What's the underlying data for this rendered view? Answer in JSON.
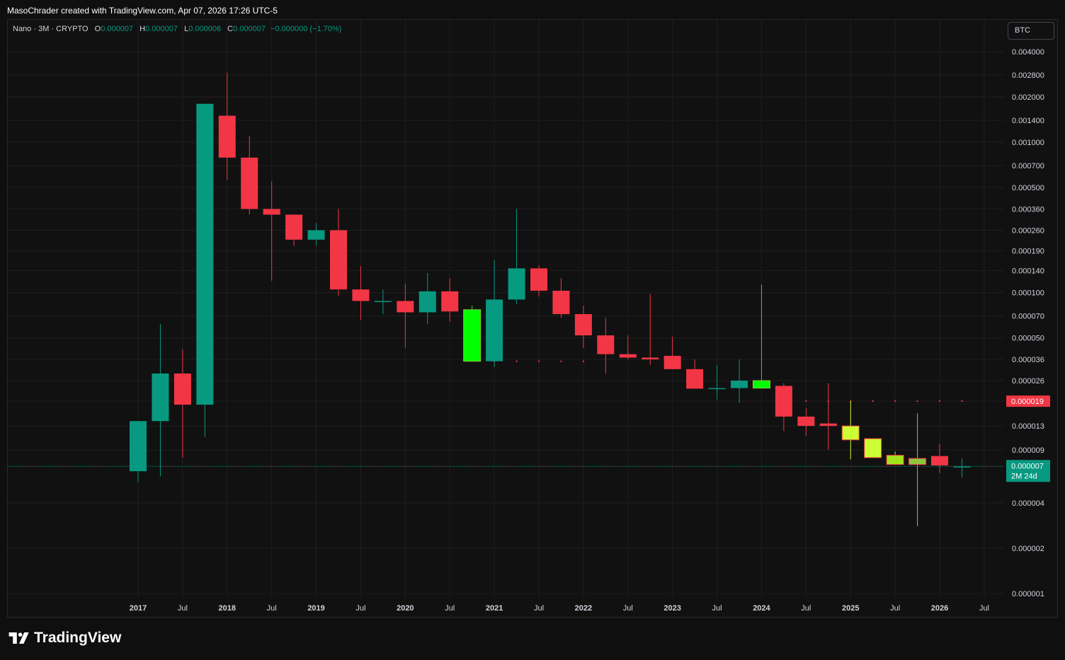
{
  "header": {
    "author": "MasoChrader",
    "attribution": "MasoChrader created with TradingView.com, Apr 07, 2026 17:26 UTC-5"
  },
  "legend": {
    "symbol": "Nano · 3M · CRYPTO",
    "o_label": "O",
    "o_value": "0.000007",
    "h_label": "H",
    "h_value": "0.000007",
    "l_label": "L",
    "l_value": "0.000006",
    "c_label": "C",
    "c_value": "0.000007",
    "change": "−0.000000 (−1.70%)"
  },
  "currency_button": "BTC",
  "footer": {
    "brand": "TradingView"
  },
  "colors": {
    "up": "#089981",
    "down": "#f23645",
    "bright_up": "#00ff00",
    "yellow_up": "#ccff33",
    "lime": "#a4e31a",
    "olive": "#8cc63f",
    "grid": "#1f1f1f",
    "marker": "#f23645",
    "price_line": "#089981"
  },
  "chart_data": {
    "type": "candlestick",
    "scale": "log",
    "y_ticks": [
      "0.004000",
      "0.002800",
      "0.002000",
      "0.001400",
      "0.001000",
      "0.000700",
      "0.000500",
      "0.000360",
      "0.000260",
      "0.000190",
      "0.000140",
      "0.000100",
      "0.000070",
      "0.000050",
      "0.000036",
      "0.000026",
      "0.000019",
      "0.000013",
      "0.000009",
      "0.000007",
      "0.000004",
      "0.000002",
      "0.000001"
    ],
    "x_ticks": [
      "2017",
      "Jul",
      "2018",
      "Jul",
      "2019",
      "Jul",
      "2020",
      "Jul",
      "2021",
      "Jul",
      "2022",
      "Jul",
      "2023",
      "Jul",
      "2024",
      "Jul",
      "2025",
      "Jul",
      "2026",
      "Jul"
    ],
    "x_range": [
      "2016-01",
      "2027-01"
    ],
    "last_price": {
      "value": "0.000007",
      "countdown": "2M 24d"
    },
    "marker_label": "0.000019",
    "candles": [
      {
        "date": "2017-01",
        "o": 6.5e-06,
        "h": 9e-06,
        "l": 5.5e-06,
        "c": 1.4e-05,
        "color": "up"
      },
      {
        "date": "2017-04",
        "o": 1.4e-05,
        "h": 6.2e-05,
        "l": 6e-06,
        "c": 2.9e-05,
        "color": "up"
      },
      {
        "date": "2017-07",
        "o": 2.9e-05,
        "h": 4.2e-05,
        "l": 8e-06,
        "c": 1.8e-05,
        "color": "down"
      },
      {
        "date": "2017-10",
        "o": 1.8e-05,
        "h": 0.0018,
        "l": 1.1e-05,
        "c": 0.0018,
        "color": "up"
      },
      {
        "date": "2018-01",
        "o": 0.0015,
        "h": 0.0029,
        "l": 0.00056,
        "c": 0.00079,
        "color": "down"
      },
      {
        "date": "2018-04",
        "o": 0.00079,
        "h": 0.0011,
        "l": 0.00033,
        "c": 0.00036,
        "color": "down"
      },
      {
        "date": "2018-07",
        "o": 0.00036,
        "h": 0.00055,
        "l": 0.00012,
        "c": 0.00033,
        "color": "down"
      },
      {
        "date": "2018-10",
        "o": 0.00033,
        "h": 0.00033,
        "l": 0.000205,
        "c": 0.000225,
        "color": "down"
      },
      {
        "date": "2019-01",
        "o": 0.000225,
        "h": 0.00029,
        "l": 0.000205,
        "c": 0.00026,
        "color": "up"
      },
      {
        "date": "2019-04",
        "o": 0.00026,
        "h": 0.00036,
        "l": 9.5e-05,
        "c": 0.000105,
        "color": "down"
      },
      {
        "date": "2019-07",
        "o": 0.000105,
        "h": 0.00015,
        "l": 6.6e-05,
        "c": 8.8e-05,
        "color": "down"
      },
      {
        "date": "2019-10",
        "o": 8.8e-05,
        "h": 0.000105,
        "l": 7.2e-05,
        "c": 8.8e-05,
        "color": "up"
      },
      {
        "date": "2020-01",
        "o": 8.8e-05,
        "h": 0.000115,
        "l": 4.3e-05,
        "c": 7.4e-05,
        "color": "down"
      },
      {
        "date": "2020-04",
        "o": 7.4e-05,
        "h": 0.000135,
        "l": 6.2e-05,
        "c": 0.000102,
        "color": "up"
      },
      {
        "date": "2020-07",
        "o": 0.000102,
        "h": 0.000125,
        "l": 6.4e-05,
        "c": 7.5e-05,
        "color": "down"
      },
      {
        "date": "2020-10",
        "o": 3.5e-05,
        "h": 8.2e-05,
        "l": 3.5e-05,
        "c": 7.7e-05,
        "color": "bright_up"
      },
      {
        "date": "2021-01",
        "o": 3.5e-05,
        "h": 0.000165,
        "l": 3.2e-05,
        "c": 9e-05,
        "color": "up"
      },
      {
        "date": "2021-04",
        "o": 9e-05,
        "h": 0.00036,
        "l": 8.4e-05,
        "c": 0.000145,
        "color": "up"
      },
      {
        "date": "2021-07",
        "o": 0.000145,
        "h": 0.000152,
        "l": 9.4e-05,
        "c": 0.000103,
        "color": "down"
      },
      {
        "date": "2021-10",
        "o": 0.000103,
        "h": 0.000125,
        "l": 6.8e-05,
        "c": 7.2e-05,
        "color": "down"
      },
      {
        "date": "2022-01",
        "o": 7.2e-05,
        "h": 8.2e-05,
        "l": 4.3e-05,
        "c": 5.2e-05,
        "color": "down"
      },
      {
        "date": "2022-04",
        "o": 5.2e-05,
        "h": 6.8e-05,
        "l": 2.9e-05,
        "c": 3.9e-05,
        "color": "down"
      },
      {
        "date": "2022-07",
        "o": 3.9e-05,
        "h": 5.2e-05,
        "l": 3.6e-05,
        "c": 3.7e-05,
        "color": "down"
      },
      {
        "date": "2022-10",
        "o": 3.7e-05,
        "h": 9.8e-05,
        "l": 3.3e-05,
        "c": 3.6e-05,
        "color": "down"
      },
      {
        "date": "2023-01",
        "o": 3.8e-05,
        "h": 5.1e-05,
        "l": 3.1e-05,
        "c": 3.1e-05,
        "color": "down"
      },
      {
        "date": "2023-04",
        "o": 3.1e-05,
        "h": 3.6e-05,
        "l": 2.3e-05,
        "c": 2.3e-05,
        "color": "down"
      },
      {
        "date": "2023-07",
        "o": 2.3e-05,
        "h": 3.3e-05,
        "l": 1.95e-05,
        "c": 2.32e-05,
        "color": "up"
      },
      {
        "date": "2023-10",
        "o": 2.32e-05,
        "h": 3.6e-05,
        "l": 1.85e-05,
        "c": 2.6e-05,
        "color": "up"
      },
      {
        "date": "2024-01",
        "o": 2.32e-05,
        "h": 0.000113,
        "l": 2.32e-05,
        "c": 2.6e-05,
        "color": "bright_up"
      },
      {
        "date": "2024-04",
        "o": 2.4e-05,
        "h": 2.5e-05,
        "l": 1.2e-05,
        "c": 1.5e-05,
        "color": "down"
      },
      {
        "date": "2024-07",
        "o": 1.5e-05,
        "h": 1.7e-05,
        "l": 1.12e-05,
        "c": 1.3e-05,
        "color": "down"
      },
      {
        "date": "2024-10",
        "o": 1.35e-05,
        "h": 2.5e-05,
        "l": 9e-06,
        "c": 1.3e-05,
        "color": "down"
      },
      {
        "date": "2025-01",
        "o": 1.05e-05,
        "h": 1.9e-05,
        "l": 7.8e-06,
        "c": 1.3e-05,
        "color": "yellow_up"
      },
      {
        "date": "2025-04",
        "o": 8e-06,
        "h": 1.07e-05,
        "l": 8e-06,
        "c": 1.07e-05,
        "color": "yellow_up"
      },
      {
        "date": "2025-07",
        "o": 7.2e-06,
        "h": 8.8e-06,
        "l": 7.2e-06,
        "c": 8.3e-06,
        "color": "lime"
      },
      {
        "date": "2025-10",
        "o": 7.2e-06,
        "h": 1.58e-05,
        "l": 2.8e-06,
        "c": 7.9e-06,
        "color": "olive"
      },
      {
        "date": "2026-01",
        "o": 8.2e-06,
        "h": 9.9e-06,
        "l": 6.3e-06,
        "c": 7.1e-06,
        "color": "down"
      },
      {
        "date": "2026-04",
        "o": 7e-06,
        "h": 7.9e-06,
        "l": 5.9e-06,
        "c": 7e-06,
        "color": "up"
      }
    ],
    "marker_dots": [
      {
        "date": "2021-01",
        "value": 3.5e-05
      },
      {
        "date": "2021-04",
        "value": 3.5e-05
      },
      {
        "date": "2021-07",
        "value": 3.5e-05
      },
      {
        "date": "2021-10",
        "value": 3.5e-05
      },
      {
        "date": "2022-01",
        "value": 3.5e-05
      },
      {
        "date": "2024-07",
        "value": 1.9e-05
      },
      {
        "date": "2024-10",
        "value": 1.9e-05
      },
      {
        "date": "2025-01",
        "value": 1.9e-05
      },
      {
        "date": "2025-04",
        "value": 1.9e-05
      },
      {
        "date": "2025-07",
        "value": 1.9e-05
      },
      {
        "date": "2025-10",
        "value": 1.9e-05
      },
      {
        "date": "2026-01",
        "value": 1.9e-05
      },
      {
        "date": "2026-04",
        "value": 1.9e-05
      }
    ]
  }
}
